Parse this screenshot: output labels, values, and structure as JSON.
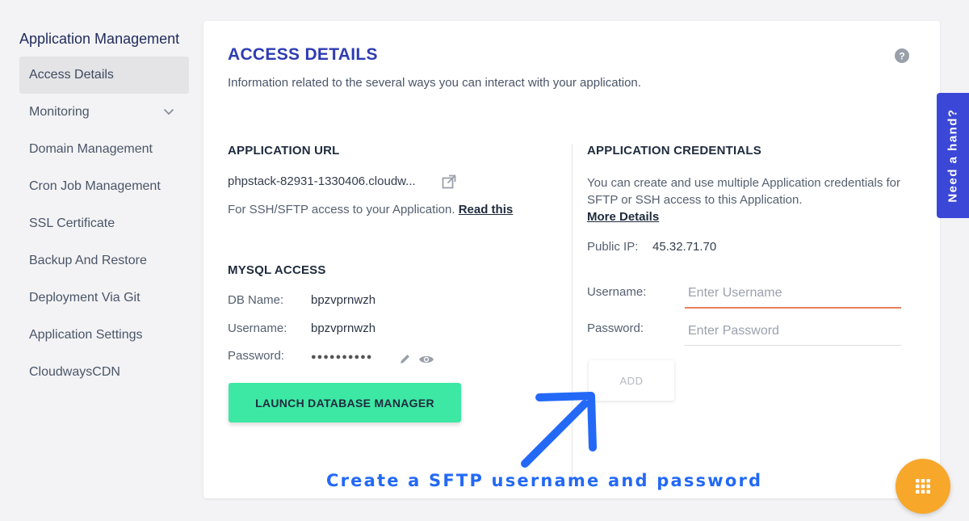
{
  "sidebar": {
    "title": "Application Management",
    "items": [
      {
        "label": "Access Details"
      },
      {
        "label": "Monitoring"
      },
      {
        "label": "Domain Management"
      },
      {
        "label": "Cron Job Management"
      },
      {
        "label": "SSL Certificate"
      },
      {
        "label": "Backup And Restore"
      },
      {
        "label": "Deployment Via Git"
      },
      {
        "label": "Application Settings"
      },
      {
        "label": "CloudwaysCDN"
      }
    ]
  },
  "main": {
    "title": "ACCESS DETAILS",
    "subtitle": "Information related to the several ways you can interact with your application.",
    "app_url": {
      "heading": "APPLICATION URL",
      "url": "phpstack-82931-1330406.cloudw...",
      "ssh_text": "For SSH/SFTP access to your Application.",
      "read_this": "Read this"
    },
    "mysql": {
      "heading": "MYSQL ACCESS",
      "db_name_label": "DB Name:",
      "db_name": "bpzvprnwzh",
      "username_label": "Username:",
      "username": "bpzvprnwzh",
      "password_label": "Password:",
      "password_masked": "●●●●●●●●●●",
      "launch_button": "LAUNCH DATABASE MANAGER"
    },
    "credentials": {
      "heading": "APPLICATION CREDENTIALS",
      "description": "You can create and use multiple Application credentials for SFTP or SSH access to this Application.",
      "more_details": "More Details",
      "public_ip_label": "Public IP:",
      "public_ip": "45.32.71.70",
      "username_label": "Username:",
      "username_placeholder": "Enter Username",
      "password_label": "Password:",
      "password_placeholder": "Enter Password",
      "add_button": "ADD"
    }
  },
  "annotation": "Create a SFTP username and password",
  "help_tab": "Need a hand?",
  "icons": {
    "help": "question-circle-icon",
    "external": "external-link-icon",
    "edit": "pencil-icon",
    "show": "eye-icon",
    "chevron": "chevron-down-icon",
    "apps": "grid-icon"
  },
  "colors": {
    "title_blue": "#2e3cb3",
    "launch_green": "#3ce8a4",
    "annotation_blue": "#2369f6",
    "help_tab": "#3b47d6",
    "fab_orange": "#f7a72a",
    "focus_underline": "#e8805a"
  }
}
